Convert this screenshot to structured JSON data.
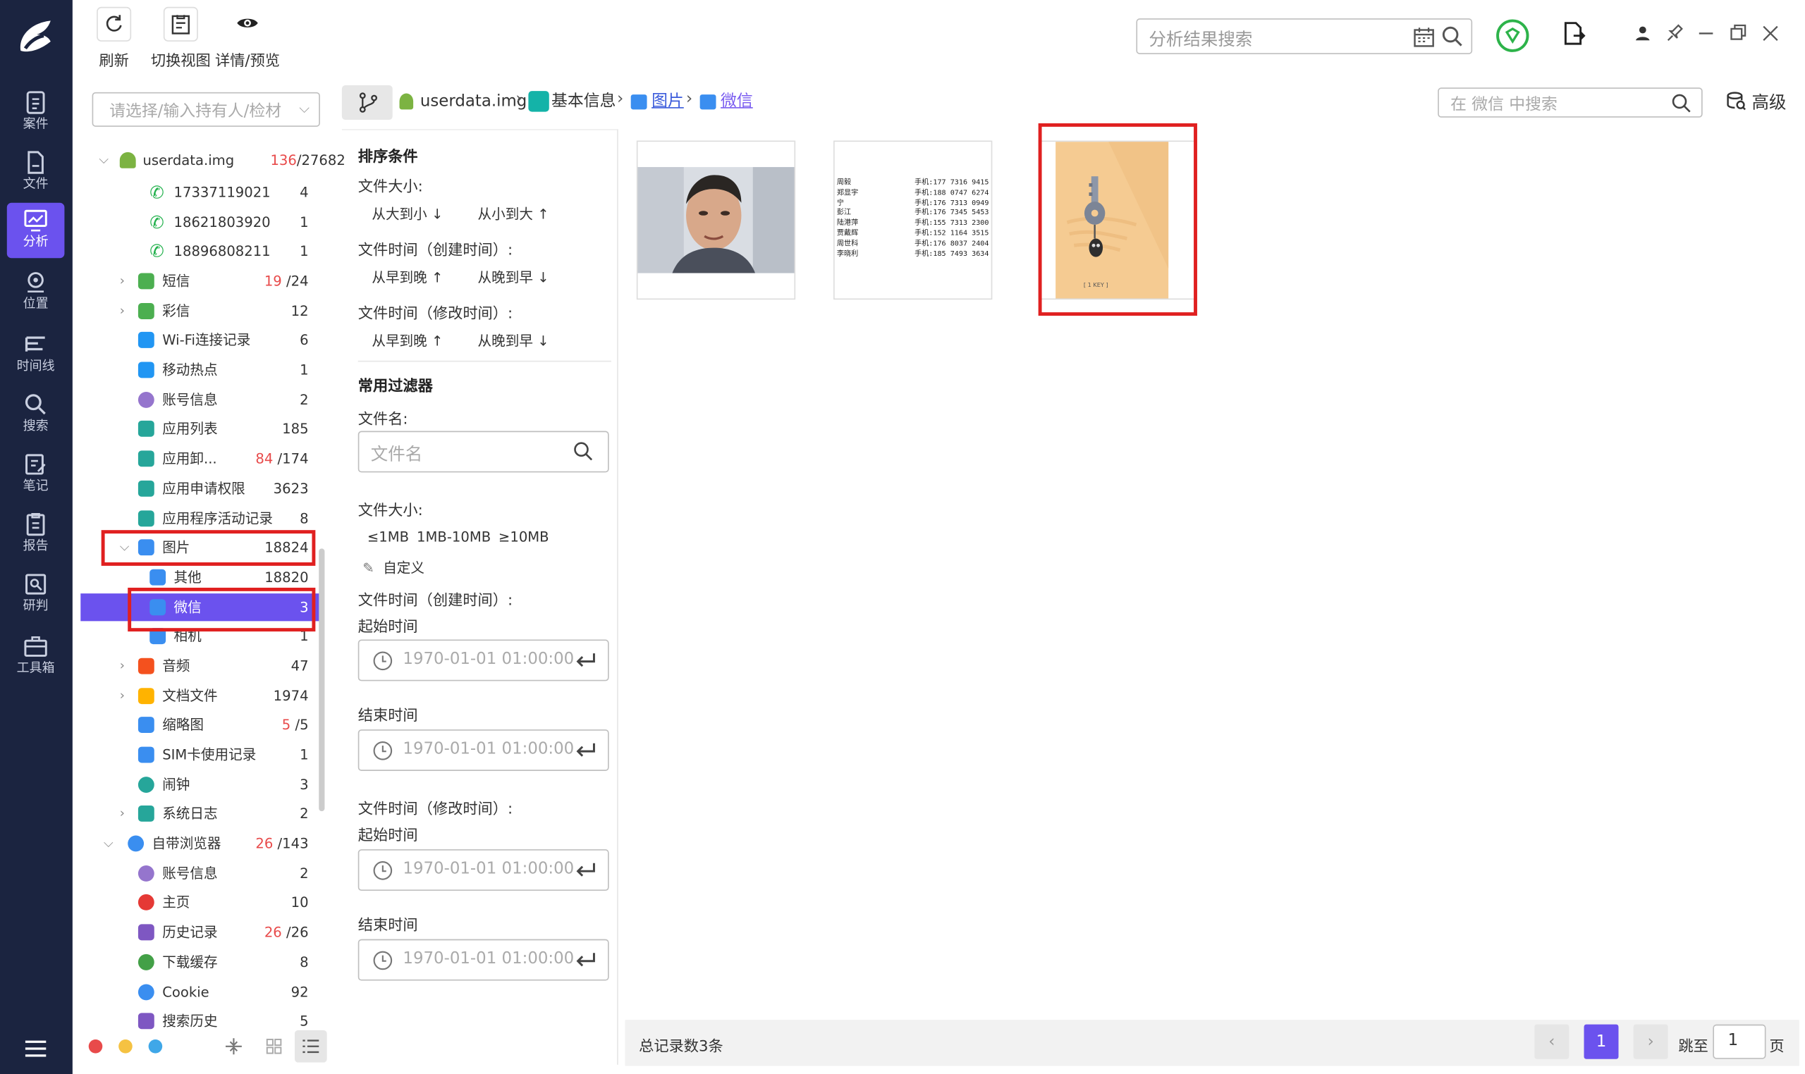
{
  "nav": {
    "items": [
      {
        "label": "案件",
        "icon": "case-icon"
      },
      {
        "label": "文件",
        "icon": "file-icon"
      },
      {
        "label": "分析",
        "icon": "analysis-icon"
      },
      {
        "label": "位置",
        "icon": "location-icon"
      },
      {
        "label": "时间线",
        "icon": "timeline-icon"
      },
      {
        "label": "搜索",
        "icon": "search-icon"
      },
      {
        "label": "笔记",
        "icon": "note-icon"
      },
      {
        "label": "报告",
        "icon": "report-icon"
      },
      {
        "label": "研判",
        "icon": "judge-icon"
      },
      {
        "label": "工具箱",
        "icon": "toolbox-icon"
      }
    ],
    "active_index": 2
  },
  "toolbar": {
    "refresh_label": "刷新",
    "switch_view_label": "切换视图",
    "detail_preview_label": "详情/预览",
    "result_search_placeholder": "分析结果搜索"
  },
  "tree": {
    "holder_placeholder": "请选择/输入持有人/检材",
    "root": {
      "label": "userdata.img",
      "count_red": "136",
      "count_total": "/27682"
    },
    "rows": [
      {
        "label": "17337119021",
        "count": "4"
      },
      {
        "label": "18621803920",
        "count": "1"
      },
      {
        "label": "18896808211",
        "count": "1"
      },
      {
        "label": "短信",
        "count_red": "19",
        "count": "/24"
      },
      {
        "label": "彩信",
        "count": "12"
      },
      {
        "label": "Wi-Fi连接记录",
        "count": "6"
      },
      {
        "label": "移动热点",
        "count": "1"
      },
      {
        "label": "账号信息",
        "count": "2"
      },
      {
        "label": "应用列表",
        "count": "185"
      },
      {
        "label": "应用卸...",
        "count_red": "84",
        "count": "/174"
      },
      {
        "label": "应用申请权限",
        "count": "3623"
      },
      {
        "label": "应用程序活动记录",
        "count": "8"
      },
      {
        "label": "图片",
        "count": "18824"
      },
      {
        "label": "其他",
        "count": "18820"
      },
      {
        "label": "微信",
        "count": "3"
      },
      {
        "label": "相机",
        "count": "1"
      },
      {
        "label": "音频",
        "count": "47"
      },
      {
        "label": "文档文件",
        "count": "1974"
      },
      {
        "label": "缩略图",
        "count_red": "5",
        "count": "/5"
      },
      {
        "label": "SIM卡使用记录",
        "count": "1"
      },
      {
        "label": "闹钟",
        "count": "3"
      },
      {
        "label": "系统日志",
        "count": "2"
      },
      {
        "label": "自带浏览器",
        "count_red": "26",
        "count": "/143"
      },
      {
        "label": "账号信息",
        "count": "2"
      },
      {
        "label": "主页",
        "count": "10"
      },
      {
        "label": "历史记录",
        "count_red": "26",
        "count": "/26"
      },
      {
        "label": "下载缓存",
        "count": "8"
      },
      {
        "label": "Cookie",
        "count": "92"
      },
      {
        "label": "搜索历史",
        "count": "5"
      }
    ],
    "selected": "微信"
  },
  "breadcrumb": {
    "items": [
      "userdata.img",
      "基本信息",
      "图片",
      "微信"
    ],
    "search_placeholder": "在 微信 中搜索",
    "advanced_label": "高级"
  },
  "filter": {
    "sort_title": "排序条件",
    "file_size_label": "文件大小:",
    "size_desc": "从大到小",
    "size_asc": "从小到大",
    "ctime_label": "文件时间（创建时间）:",
    "ctime_asc": "从早到晚",
    "ctime_desc": "从晚到早",
    "mtime_label": "文件时间（修改时间）:",
    "mtime_asc": "从早到晚",
    "mtime_desc": "从晚到早",
    "common_title": "常用过滤器",
    "filename_label": "文件名:",
    "filename_placeholder": "文件名",
    "size_label2": "文件大小:",
    "size_opts": [
      "≤1MB",
      "1MB-10MB",
      "≥10MB"
    ],
    "custom_label": "自定义",
    "ctime_label2": "文件时间（创建时间）:",
    "start_label": "起始时间",
    "end_label": "结束时间",
    "mtime_label2": "文件时间（修改时间）:",
    "start_label2": "起始时间",
    "end_label2": "结束时间",
    "date_placeholder": "1970-01-01 01:00:00"
  },
  "gallery": {
    "contacts": [
      {
        "name": "周毅",
        "phone": "手机:177 7316 9415"
      },
      {
        "name": "郑显宇",
        "phone": "手机:188 0747 6274"
      },
      {
        "name": "宁",
        "phone": "手机:176 7313 0949"
      },
      {
        "name": "彭江",
        "phone": "手机:176 7345 5453"
      },
      {
        "name": "陆港萍",
        "phone": "手机:155 7313 2300"
      },
      {
        "name": "贾戴辉",
        "phone": "手机:152 1164 3515"
      },
      {
        "name": "周世科",
        "phone": "手机:176 8037 2404"
      },
      {
        "name": "李晓利",
        "phone": "手机:185 7493 3634"
      }
    ],
    "key_caption": "[ 1 KEY ]"
  },
  "status": {
    "total": "总记录数3条",
    "page": "1",
    "jump_label": "跳至",
    "jump_value": "1",
    "page_suffix": "页"
  },
  "colors": {
    "accent": "#6b52ee",
    "nav_bg": "#1b2440",
    "highlight": "#e02020"
  }
}
